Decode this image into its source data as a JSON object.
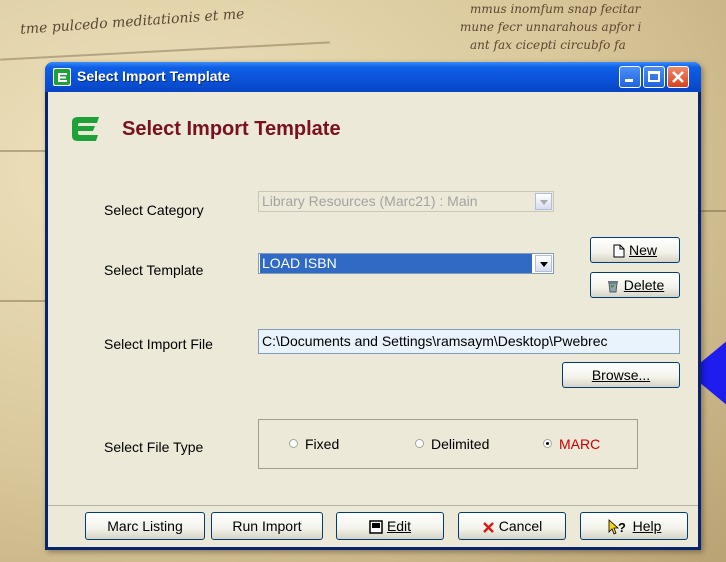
{
  "background": {
    "line1": "tme pulcedo meditationis et me",
    "line2": "mmus inomfum snap fecitar",
    "line3": "mune fecr  unnarahous apfor i",
    "line4": "ant fax cicepti circubfo fa"
  },
  "window": {
    "title": "Select Import Template",
    "header_title": "Select Import Template"
  },
  "form": {
    "category": {
      "label": "Select Category",
      "value": "Library Resources (Marc21) : Main"
    },
    "template": {
      "label": "Select Template",
      "value": "LOAD ISBN"
    },
    "import_file": {
      "label": "Select Import File",
      "value": "C:\\Documents and Settings\\ramsaym\\Desktop\\Pwebrec"
    },
    "file_type": {
      "label": "Select File Type",
      "options": [
        {
          "label": "Fixed",
          "selected": false
        },
        {
          "label": "Delimited",
          "selected": false
        },
        {
          "label": "MARC",
          "selected": true
        }
      ]
    }
  },
  "buttons": {
    "new": "New",
    "delete": "Delete",
    "browse": "Browse...",
    "marc_listing": "Marc Listing",
    "run_import": "Run Import",
    "edit": "Edit",
    "cancel": "Cancel",
    "help": "Help"
  },
  "colors": {
    "title_bar": "#0a52d8",
    "header_text": "#7a1020",
    "selected_template_bg": "#316ac5",
    "file_field_bg": "#e8f3fb",
    "selected_radio_text": "#cc0000",
    "pointer_arrow": "#1f1cf0"
  }
}
